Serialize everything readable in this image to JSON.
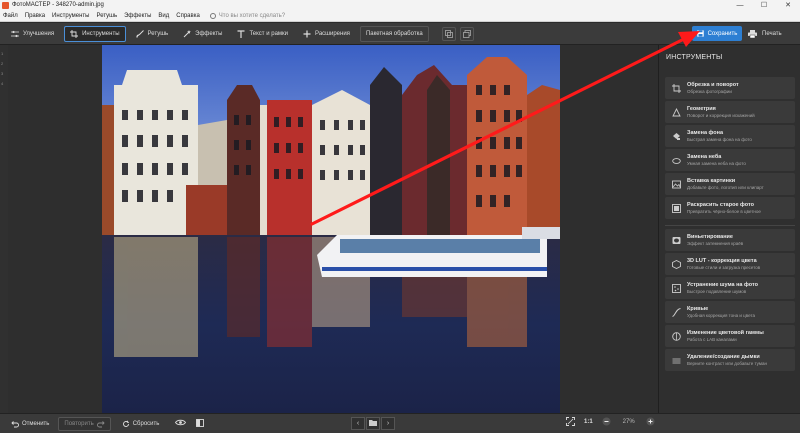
{
  "window": {
    "title": "ФотоМАСТЕР - 348270-admin.jpg",
    "minimize_glyph": "—",
    "maximize_glyph": "☐",
    "close_glyph": "✕"
  },
  "menu": {
    "items": [
      "Файл",
      "Правка",
      "Инструменты",
      "Ретушь",
      "Эффекты",
      "Вид",
      "Справка"
    ],
    "search_placeholder": "Что вы хотите сделать?"
  },
  "toolbar": {
    "tabs": [
      {
        "label": "Улучшения",
        "icon": "sliders-icon"
      },
      {
        "label": "Инструменты",
        "icon": "crop-icon"
      },
      {
        "label": "Ретушь",
        "icon": "brush-icon"
      },
      {
        "label": "Эффекты",
        "icon": "magic-wand-icon"
      },
      {
        "label": "Текст и рамки",
        "icon": "text-icon"
      },
      {
        "label": "Расширения",
        "icon": "plus-icon"
      },
      {
        "label": "Пакетная обработка",
        "icon": "batch-icon"
      }
    ],
    "active_tab": "Инструменты",
    "save_label": "Сохранить",
    "print_label": "Печать"
  },
  "ruler": {
    "marks": [
      "1",
      "2",
      "3",
      "4"
    ]
  },
  "panel": {
    "title": "ИНСТРУМЕНТЫ",
    "tools": [
      {
        "title": "Обрезка и поворот",
        "subtitle": "Обрезка фотографии",
        "icon": "crop-rotate-icon"
      },
      {
        "title": "Геометрия",
        "subtitle": "Поворот и коррекция искажений",
        "icon": "geometry-icon"
      },
      {
        "title": "Замена фона",
        "subtitle": "Быстрая замена фона на фото",
        "icon": "background-replace-icon"
      },
      {
        "title": "Замена неба",
        "subtitle": "Умная замена неба на фото",
        "icon": "sky-replace-icon"
      },
      {
        "title": "Вставка картинки",
        "subtitle": "Добавьте фото, логотип или клипарт",
        "icon": "insert-image-icon"
      },
      {
        "title": "Раскрасить старое фото",
        "subtitle": "Превратить чёрно-белое в цветное",
        "icon": "colorize-icon"
      },
      {
        "title": "Виньетирование",
        "subtitle": "Эффект затемнения краёв",
        "icon": "vignette-icon"
      },
      {
        "title": "3D LUT - коррекция цвета",
        "subtitle": "Готовые стили и загрузка пресетов",
        "icon": "lut-icon"
      },
      {
        "title": "Устранение шума на фото",
        "subtitle": "Быстрое подавление шумов",
        "icon": "denoise-icon"
      },
      {
        "title": "Кривые",
        "subtitle": "Удобная коррекция тона и цвета",
        "icon": "curves-icon"
      },
      {
        "title": "Изменение цветовой гаммы",
        "subtitle": "Работа с LAB каналами",
        "icon": "color-gamut-icon"
      },
      {
        "title": "Удаление/создание дымки",
        "subtitle": "Верните контраст или добавьте туман",
        "icon": "haze-icon"
      }
    ]
  },
  "bottom": {
    "undo_label": "Отменить",
    "redo_label": "Повторить",
    "reset_label": "Сбросить",
    "zoom_ratio": "1:1",
    "zoom_percent": "27%",
    "prev_glyph": "‹",
    "next_glyph": "›"
  },
  "colors": {
    "accent": "#2d7fd3",
    "annotation_arrow": "#ff1a1a"
  }
}
